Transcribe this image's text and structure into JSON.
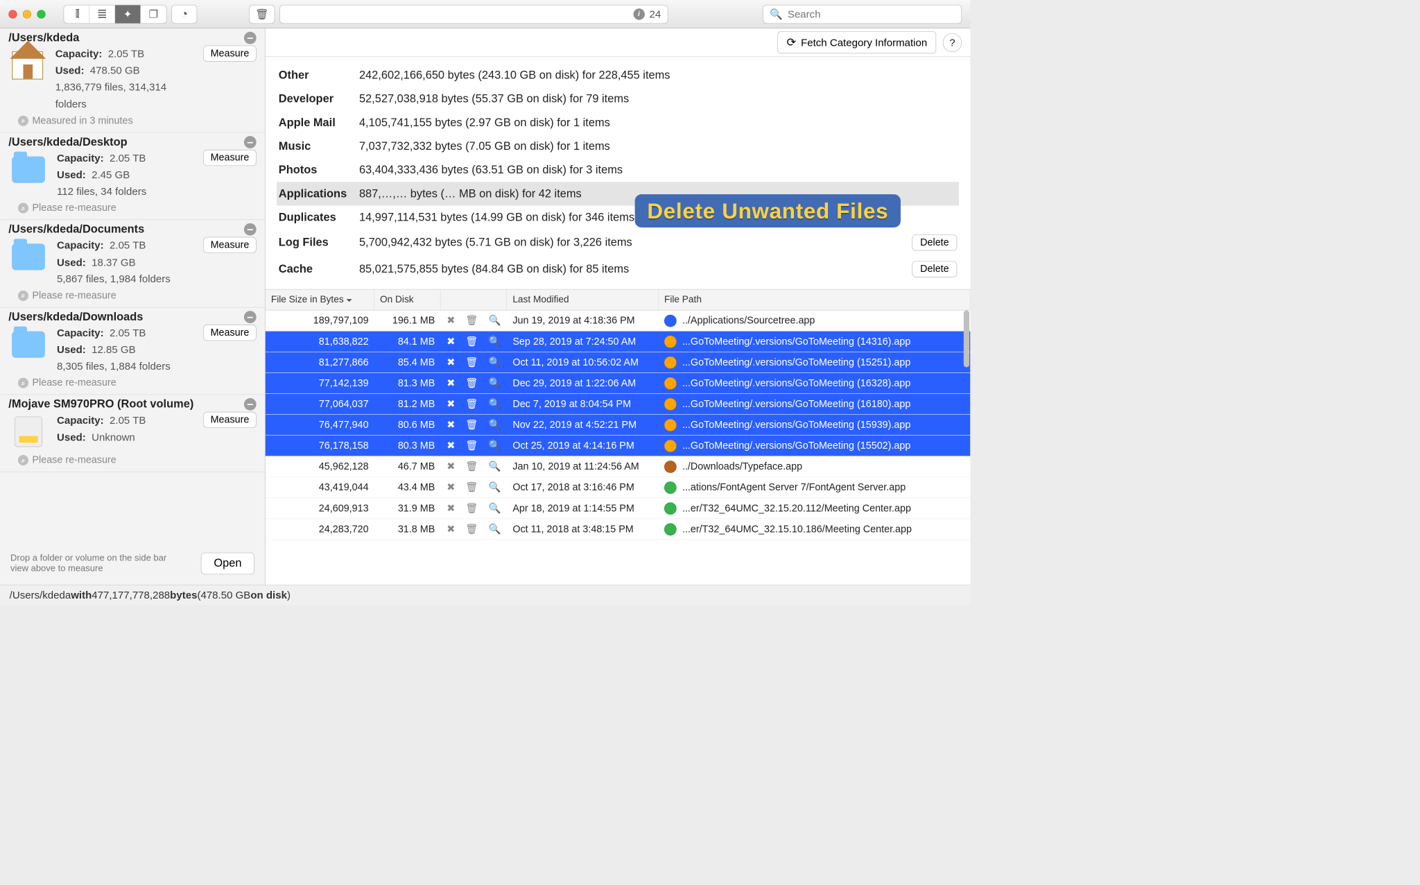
{
  "toolbar": {
    "info_count": "24",
    "search_placeholder": "Search"
  },
  "main_header": {
    "fetch_label": "Fetch Category Information"
  },
  "overlay_text": "Delete Unwanted Files",
  "sidebar": {
    "drop_hint": "Drop a folder or volume on the side bar view above to measure",
    "open_label": "Open",
    "volumes": [
      {
        "path": "/Users/kdeda",
        "capacity_label": "Capacity:",
        "capacity": "2.05 TB",
        "used_label": "Used:",
        "used": "478.50 GB",
        "detail": "1,836,779 files, 314,314 folders",
        "note": "Measured in 3 minutes",
        "measure": "Measure",
        "icon": "home"
      },
      {
        "path": "/Users/kdeda/Desktop",
        "capacity_label": "Capacity:",
        "capacity": "2.05 TB",
        "used_label": "Used:",
        "used": "2.45 GB",
        "detail": "112 files, 34 folders",
        "note": "Please re-measure",
        "measure": "Measure",
        "icon": "folder"
      },
      {
        "path": "/Users/kdeda/Documents",
        "capacity_label": "Capacity:",
        "capacity": "2.05 TB",
        "used_label": "Used:",
        "used": "18.37 GB",
        "detail": "5,867 files, 1,984 folders",
        "note": "Please re-measure",
        "measure": "Measure",
        "icon": "folder"
      },
      {
        "path": "/Users/kdeda/Downloads",
        "capacity_label": "Capacity:",
        "capacity": "2.05 TB",
        "used_label": "Used:",
        "used": "12.85 GB",
        "detail": "8,305 files, 1,884 folders",
        "note": "Please re-measure",
        "measure": "Measure",
        "icon": "folder"
      },
      {
        "path": "/Mojave SM970PRO (Root volume)",
        "capacity_label": "Capacity:",
        "capacity": "2.05 TB",
        "used_label": "Used:",
        "used": "Unknown",
        "detail": "",
        "note": "Please re-measure",
        "measure": "Measure",
        "icon": "drive"
      }
    ]
  },
  "categories": [
    {
      "label": "Other",
      "value": "242,602,166,650 bytes (243.10 GB on disk) for 228,455 items"
    },
    {
      "label": "Developer",
      "value": "52,527,038,918 bytes (55.37 GB on disk) for 79 items"
    },
    {
      "label": "Apple Mail",
      "value": "4,105,741,155 bytes (2.97 GB on disk) for 1 items"
    },
    {
      "label": "Music",
      "value": "7,037,732,332 bytes (7.05 GB on disk) for 1 items"
    },
    {
      "label": "Photos",
      "value": "63,404,333,436 bytes (63.51 GB on disk) for 3 items"
    },
    {
      "label": "Applications",
      "value": "887,…,… bytes (… MB on disk) for 42 items",
      "selected": true
    },
    {
      "label": "Duplicates",
      "value": "14,997,114,531 bytes (14.99 GB on disk) for 346 items"
    },
    {
      "label": "Log Files",
      "value": "5,700,942,432 bytes (5.71 GB on disk) for 3,226 items",
      "delete": "Delete"
    },
    {
      "label": "Cache",
      "value": "85,021,575,855 bytes (84.84 GB on disk) for 85 items",
      "delete": "Delete"
    }
  ],
  "grid": {
    "headers": {
      "size": "File Size in Bytes",
      "disk": "On Disk",
      "date": "Last Modified",
      "path": "File Path"
    },
    "rows": [
      {
        "size": "189,797,109",
        "disk": "196.1 MB",
        "date": "Jun 19, 2019 at 4:18:36 PM",
        "path": "../Applications/Sourcetree.app",
        "sel": false,
        "iconClass": "b"
      },
      {
        "size": "81,638,822",
        "disk": "84.1 MB",
        "date": "Sep 28, 2019 at 7:24:50 AM",
        "path": "...GoToMeeting/.versions/GoToMeeting (14316).app",
        "sel": true,
        "iconClass": "o"
      },
      {
        "size": "81,277,866",
        "disk": "85.4 MB",
        "date": "Oct 11, 2019 at 10:56:02 AM",
        "path": "...GoToMeeting/.versions/GoToMeeting (15251).app",
        "sel": true,
        "iconClass": "o"
      },
      {
        "size": "77,142,139",
        "disk": "81.3 MB",
        "date": "Dec 29, 2019 at 1:22:06 AM",
        "path": "...GoToMeeting/.versions/GoToMeeting (16328).app",
        "sel": true,
        "iconClass": "o"
      },
      {
        "size": "77,064,037",
        "disk": "81.2 MB",
        "date": "Dec 7, 2019 at 8:04:54 PM",
        "path": "...GoToMeeting/.versions/GoToMeeting (16180).app",
        "sel": true,
        "iconClass": "o"
      },
      {
        "size": "76,477,940",
        "disk": "80.6 MB",
        "date": "Nov 22, 2019 at 4:52:21 PM",
        "path": "...GoToMeeting/.versions/GoToMeeting (15939).app",
        "sel": true,
        "iconClass": "o"
      },
      {
        "size": "76,178,158",
        "disk": "80.3 MB",
        "date": "Oct 25, 2019 at 4:14:16 PM",
        "path": "...GoToMeeting/.versions/GoToMeeting (15502).app",
        "sel": true,
        "iconClass": "o"
      },
      {
        "size": "45,962,128",
        "disk": "46.7 MB",
        "date": "Jan 10, 2019 at 11:24:56 AM",
        "path": "../Downloads/Typeface.app",
        "sel": false,
        "iconClass": "r"
      },
      {
        "size": "43,419,044",
        "disk": "43.4 MB",
        "date": "Oct 17, 2018 at 3:16:46 PM",
        "path": "...ations/FontAgent Server 7/FontAgent Server.app",
        "sel": false,
        "iconClass": "g"
      },
      {
        "size": "24,609,913",
        "disk": "31.9 MB",
        "date": "Apr 18, 2019 at 1:14:55 PM",
        "path": "...er/T32_64UMC_32.15.20.112/Meeting Center.app",
        "sel": false,
        "iconClass": "g"
      },
      {
        "size": "24,283,720",
        "disk": "31.8 MB",
        "date": "Oct 11, 2018 at 3:48:15 PM",
        "path": "...er/T32_64UMC_32.15.10.186/Meeting Center.app",
        "sel": false,
        "iconClass": "g"
      }
    ]
  },
  "status": {
    "prefix": "/Users/kdeda ",
    "with": "with",
    "bytes": " 477,177,778,288 ",
    "bytes_word": "bytes",
    "paren_open": " (478.50 GB ",
    "ondisk": "on disk",
    "paren_close": ")"
  }
}
